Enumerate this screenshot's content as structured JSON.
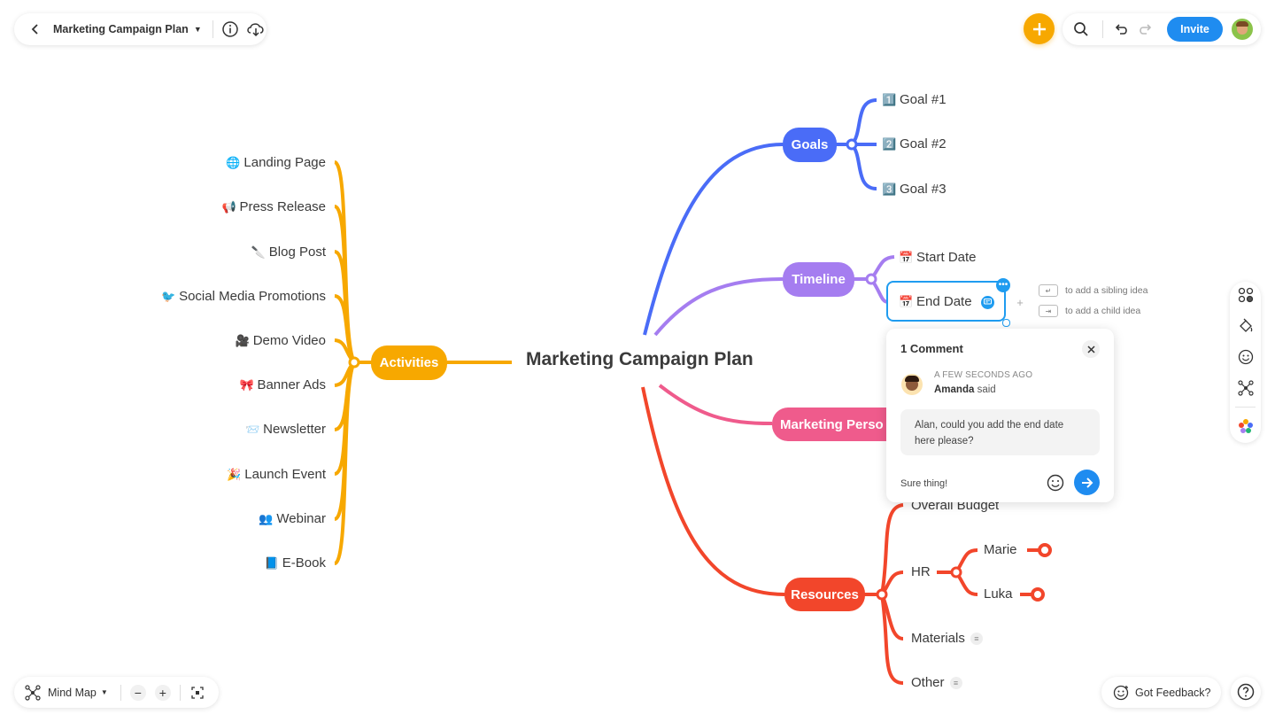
{
  "header": {
    "title": "Marketing Campaign Plan",
    "invite_label": "Invite"
  },
  "footer": {
    "view_label": "Mind Map",
    "feedback_label": "Got Feedback?"
  },
  "mindmap": {
    "center": "Marketing Campaign Plan",
    "branches": {
      "activities": {
        "label": "Activities",
        "color": "#F7A800",
        "children": [
          {
            "icon": "🌐",
            "label": "Landing Page"
          },
          {
            "icon": "📢",
            "label": "Press Release"
          },
          {
            "icon": "🔪",
            "label": "Blog Post"
          },
          {
            "icon": "🐦",
            "label": "Social Media Promotions"
          },
          {
            "icon": "🎥",
            "label": "Demo Video"
          },
          {
            "icon": "🎀",
            "label": "Banner Ads"
          },
          {
            "icon": "📨",
            "label": "Newsletter"
          },
          {
            "icon": "🎉",
            "label": "Launch Event"
          },
          {
            "icon": "👥",
            "label": "Webinar"
          },
          {
            "icon": "📘",
            "label": "E-Book"
          }
        ]
      },
      "goals": {
        "label": "Goals",
        "color": "#4A6CF7",
        "children": [
          {
            "icon": "1️⃣",
            "label": "Goal #1"
          },
          {
            "icon": "2️⃣",
            "label": "Goal #2"
          },
          {
            "icon": "3️⃣",
            "label": "Goal #3"
          }
        ]
      },
      "timeline": {
        "label": "Timeline",
        "color": "#A57DF0",
        "children": [
          {
            "icon": "📅",
            "label": "Start Date"
          },
          {
            "icon": "📅",
            "label": "End Date"
          }
        ]
      },
      "personas": {
        "label": "Marketing Perso",
        "color": "#EF5B8C"
      },
      "resources": {
        "label": "Resources",
        "color": "#F2462B",
        "children": [
          {
            "label": "Overall Budget"
          },
          {
            "label": "HR"
          },
          {
            "label": "Materials"
          },
          {
            "label": "Other"
          }
        ],
        "hr_children": [
          {
            "label": "Marie"
          },
          {
            "label": "Luka"
          }
        ]
      }
    }
  },
  "hints": {
    "sibling": "to add a sibling idea",
    "child": "to add a child idea"
  },
  "comment": {
    "title": "1 Comment",
    "time": "A FEW SECONDS AGO",
    "author": "Amanda",
    "said": "said",
    "text": "Alan, could you add the end date here please?",
    "reply_value": "Sure thing!"
  },
  "icons": {
    "back": "chevron-left-icon",
    "info": "info-icon",
    "cloud": "cloud-download-icon",
    "add": "plus-icon",
    "search": "search-icon",
    "undo": "undo-icon",
    "redo": "redo-icon"
  }
}
